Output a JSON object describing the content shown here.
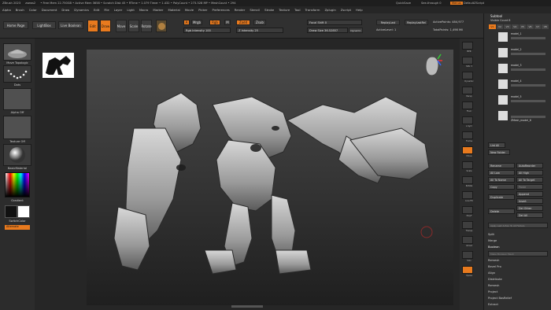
{
  "titlebar": {
    "app": "ZBrush 2023",
    "doc": "zsews2",
    "mem": "• Free Mem 22.750GB • Active Mem 3658 • Scratch Disk 45 • RTime • 1.079 Timer • 1.432 • PolyCount • 273.328 MP • MeshCount • 294",
    "quicksave": "QuickSave",
    "seethrough": "See-through 0",
    "menus": "Menus",
    "script": "DefaultZScript"
  },
  "menubar": [
    "Alpha",
    "Brush",
    "Color",
    "Document",
    "Draw",
    "Dynamics",
    "Edit",
    "File",
    "Layer",
    "Light",
    "Macro",
    "Marker",
    "Material",
    "Movie",
    "Picker",
    "Preferences",
    "Render",
    "Stencil",
    "Stroke",
    "Texture",
    "Tool",
    "Transform",
    "Zplugin",
    "Zscript",
    "Help"
  ],
  "toolbar": {
    "home": "Home Page",
    "lightbox": "LightBox",
    "livebool": "Live Boolean",
    "edit": "Edit",
    "draw": "Draw",
    "move": "Move",
    "scale": "Scale",
    "rotate": "Rotate",
    "a": "A",
    "mrgb": "Mrgb",
    "rgb": "Rgb",
    "m": "M",
    "rgb_intensity": "Rgb Intensity 100",
    "zadd": "Zadd",
    "zsub": "Zsub",
    "z_intensity": "Z Intensity 25",
    "focal": "Focal Shift 0",
    "drawsize": "Draw Size 36.52857",
    "dynamic": "Dynamic",
    "replaylast": "ReplayLast",
    "replaylastrel": "ReplayLastRel",
    "activepoints": "ActivePoints: 484,977",
    "activelevel": "ActiveLevel: 1",
    "totalpoints": "TotalPoints: 1,498 Mil"
  },
  "leftshelf": {
    "brush": "Move Topologic",
    "stroke": "Dots",
    "alpha": "Alpha Off",
    "texture": "Texture Off",
    "material": "BasicMaterial",
    "gradient": "Gradient",
    "switch": "SwitchColor",
    "alternate": "Alternate"
  },
  "rightshelf": [
    "BPR",
    "SPix 3",
    "Dynamic",
    "Persp",
    "Floor",
    "L.Sym",
    "Frame",
    "Move",
    "Scale",
    "Rotate",
    "Line Fill",
    "PolyF",
    "Transp",
    "Ghost",
    "Solo",
    "Xpose"
  ],
  "subtool": {
    "title": "Subtool",
    "visible": "Visible Count 8",
    "tabs": [
      "V1",
      "V2",
      "V3",
      "V4",
      "V5",
      "V6",
      "V7",
      "V8"
    ],
    "items": [
      "model_1",
      "model_2",
      "model_3",
      "model_4",
      "model_5",
      "ZMesh_model_6"
    ]
  },
  "panel": {
    "listall": "List All",
    "newfolder": "New Folder",
    "rename": "Rename",
    "autoreorder": "AutoReorder",
    "alllow": "All Low",
    "allhigh": "All High",
    "alltoname": "All To Name",
    "alltotarget": "All To Target",
    "copy": "Copy",
    "paste": "Paste",
    "append": "Append",
    "duplicate": "Duplicate",
    "insert": "Insert",
    "delete": "Delete",
    "delother": "Del Other",
    "delall": "Del All",
    "applylast": "Apply Last Action To All Folders",
    "split": "Split",
    "merge": "Merge",
    "boolean": "Boolean",
    "booleanopt": "Make Boolean Mesh",
    "remesh": "Remesh",
    "bevelpro": "Bevel Pro",
    "align": "Align",
    "distribute": "Distribute",
    "project": "Project",
    "projectbas": "Project BasRelief",
    "extract": "Extract"
  },
  "colors": {
    "accent": "#e87a1e",
    "bg": "#2a2a2a",
    "panel": "#2f2f2f"
  }
}
